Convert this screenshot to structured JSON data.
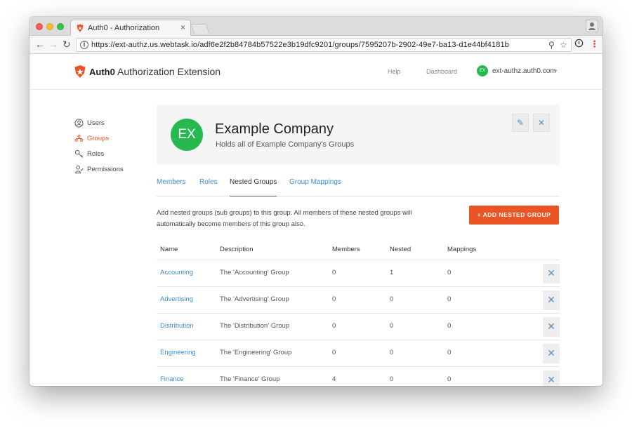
{
  "browser": {
    "tab_title": "Auth0 - Authorization",
    "tab_close": "×",
    "url": "https://ext-authz.us.webtask.io/adf6e2f2b84784b57522e3b19dfc9201/groups/7595207b-2902-49e7-ba13-d1e44bf4181b",
    "nav": {
      "back": "←",
      "forward": "→",
      "reload": "↻"
    },
    "icons": {
      "info": "i",
      "search": "⚲",
      "star": "☆",
      "menu": "⋮"
    }
  },
  "header": {
    "brand": "Auth0",
    "app_name": "Authorization Extension",
    "help": "Help",
    "dashboard": "Dashboard",
    "user_initials": "EX",
    "user_name": "ext-authz.auth0.com",
    "caret": "⌄"
  },
  "sidebar": {
    "items": [
      {
        "label": "Users",
        "icon": "user-circle-icon",
        "active": false
      },
      {
        "label": "Groups",
        "icon": "groups-icon",
        "active": true
      },
      {
        "label": "Roles",
        "icon": "roles-icon",
        "active": false
      },
      {
        "label": "Permissions",
        "icon": "permissions-icon",
        "active": false
      }
    ]
  },
  "group": {
    "initials": "EX",
    "name": "Example Company",
    "description": "Holds all of Example Company's Groups",
    "edit_icon": "✎",
    "close_icon": "✕"
  },
  "tabs": [
    {
      "label": "Members",
      "active": false
    },
    {
      "label": "Roles",
      "active": false
    },
    {
      "label": "Nested Groups",
      "active": true
    },
    {
      "label": "Group Mappings",
      "active": false
    }
  ],
  "nested": {
    "description": "Add nested groups (sub groups) to this group. All members of these nested groups will automatically become members of this group also.",
    "add_button": "+   ADD NESTED GROUP"
  },
  "table": {
    "columns": [
      "Name",
      "Description",
      "Members",
      "Nested",
      "Mappings"
    ],
    "delete_icon": "✕",
    "rows": [
      {
        "name": "Accounting",
        "description": "The 'Accounting' Group",
        "members": "0",
        "nested": "1",
        "mappings": "0"
      },
      {
        "name": "Advertising",
        "description": "The 'Advertising' Group",
        "members": "0",
        "nested": "0",
        "mappings": "0"
      },
      {
        "name": "Distribution",
        "description": "The 'Distribution' Group",
        "members": "0",
        "nested": "0",
        "mappings": "0"
      },
      {
        "name": "Engineering",
        "description": "The 'Engineering' Group",
        "members": "0",
        "nested": "0",
        "mappings": "0"
      },
      {
        "name": "Finance",
        "description": "The 'Finance' Group",
        "members": "4",
        "nested": "0",
        "mappings": "0"
      }
    ]
  },
  "colors": {
    "accent": "#eb5424",
    "link": "#3e8fd0",
    "avatar_green": "#26b94f"
  }
}
